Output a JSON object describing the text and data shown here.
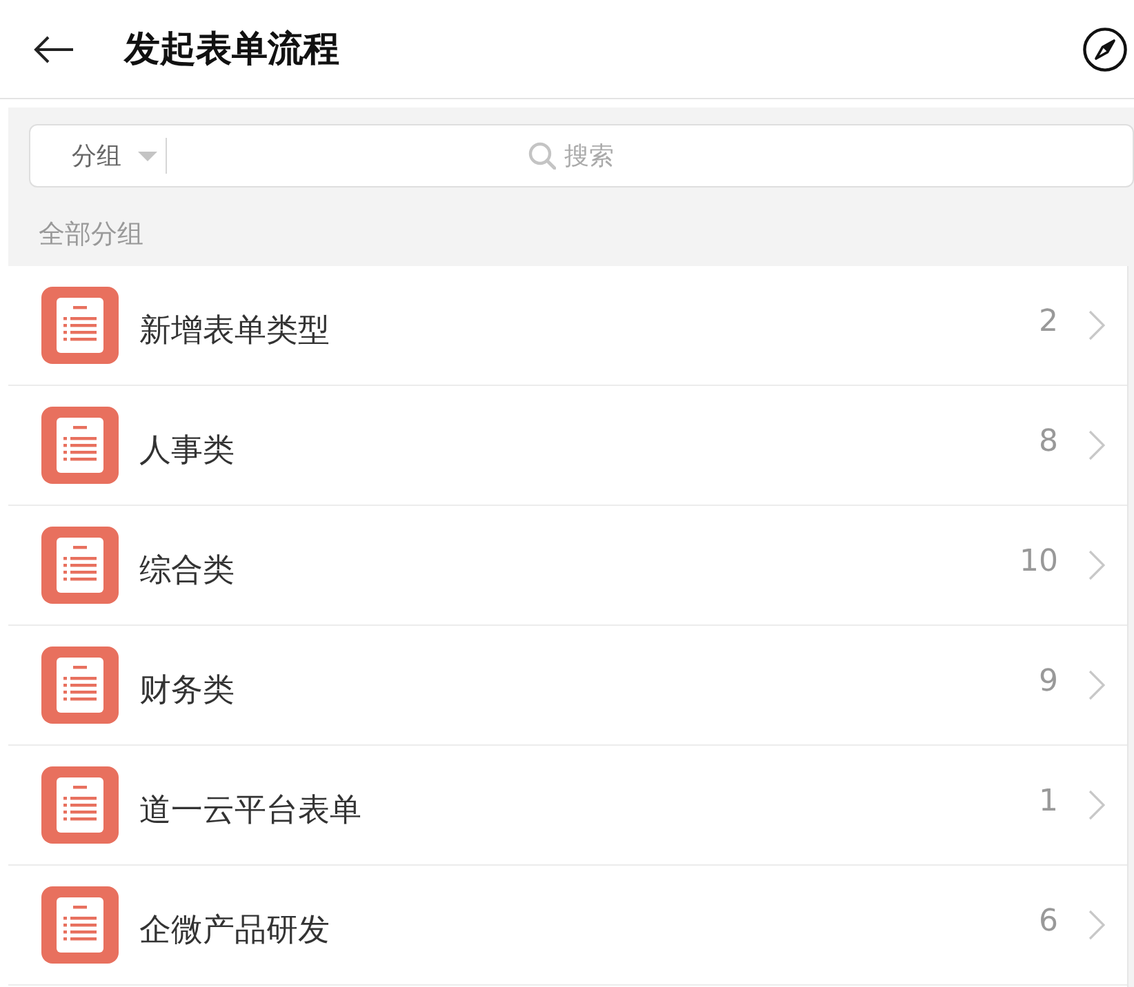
{
  "header": {
    "title": "发起表单流程"
  },
  "search": {
    "group_label": "分组",
    "placeholder": "搜索"
  },
  "section": {
    "title": "全部分组"
  },
  "groups": [
    {
      "name": "新增表单类型",
      "count": "2"
    },
    {
      "name": "人事类",
      "count": "8"
    },
    {
      "name": "综合类",
      "count": "10"
    },
    {
      "name": "财务类",
      "count": "9"
    },
    {
      "name": "道一云平台表单",
      "count": "1"
    },
    {
      "name": "企微产品研发",
      "count": "6"
    }
  ]
}
